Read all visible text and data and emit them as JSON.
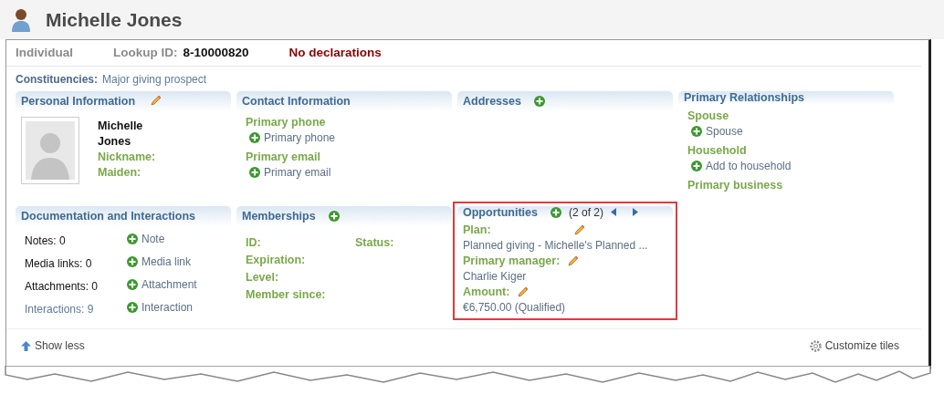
{
  "header": {
    "title": "Michelle Jones"
  },
  "summary": {
    "type": "Individual",
    "lookup_label": "Lookup ID:",
    "lookup_id": "8-10000820",
    "declarations": "No declarations"
  },
  "constituencies": {
    "label": "Constituencies:",
    "value": "Major giving prospect"
  },
  "tiles": [
    {
      "kind": "personal",
      "title": "Personal Information",
      "editable": true,
      "name_lines": [
        "Michelle",
        "Jones"
      ],
      "fields": [
        "Nickname:",
        "Maiden:"
      ]
    },
    {
      "kind": "groups",
      "title": "Contact Information",
      "groups": [
        {
          "label": "Primary phone",
          "add": "Primary phone"
        },
        {
          "label": "Primary email",
          "add": "Primary email"
        }
      ]
    },
    {
      "kind": "empty",
      "title": "Addresses",
      "addable": true
    },
    {
      "kind": "groups",
      "title": "Primary Relationships",
      "groups": [
        {
          "label": "Spouse",
          "add": "Spouse"
        },
        {
          "label": "Household",
          "add": "Add to household"
        },
        {
          "label": "Primary business"
        }
      ]
    },
    {
      "kind": "docs",
      "title": "Documentation and Interactions",
      "rows": [
        {
          "count": "Notes: 0",
          "link": false,
          "add": "Note"
        },
        {
          "count": "Media links: 0",
          "link": false,
          "add": "Media link"
        },
        {
          "count": "Attachments: 0",
          "link": false,
          "add": "Attachment"
        },
        {
          "count": "Interactions: 9",
          "link": true,
          "add": "Interaction"
        }
      ]
    },
    {
      "kind": "fields",
      "title": "Memberships",
      "addable": true,
      "left": [
        "ID:",
        "Expiration:",
        "Level:",
        "Member since:"
      ],
      "right": [
        "Status:"
      ]
    },
    {
      "kind": "opportunity",
      "title": "Opportunities",
      "addable": true,
      "pager": "(2 of 2)",
      "highlighted": true,
      "items": [
        {
          "label": "Plan:",
          "value": "Planned giving - Michelle's Planned ..."
        },
        {
          "label": "Primary manager:",
          "value": "Charlie Kiger"
        },
        {
          "label": "Amount:",
          "value": "€6,750.00 (Qualified)"
        }
      ]
    }
  ],
  "footer": {
    "show_less": "Show less",
    "customize": "Customize tiles"
  }
}
